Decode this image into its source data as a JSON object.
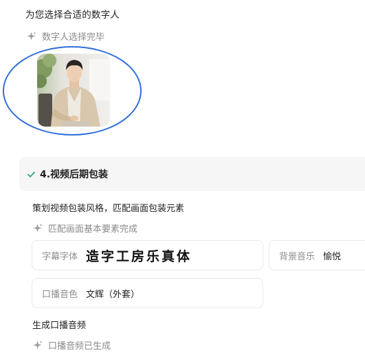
{
  "section_heading": "为您选择合适的数字人",
  "digital_human_status": "数字人选择完毕",
  "step": {
    "title": "4.视频后期包装",
    "description": "策划视频包装风格，匹配画面包装元素",
    "elements_status": "匹配画面基本要素完成",
    "fields": {
      "subtitle_font": {
        "label": "字幕字体",
        "value": "造字工房乐真体"
      },
      "background_music": {
        "label": "背景音乐",
        "value": "愉悦"
      },
      "voice_tone": {
        "label": "口播音色",
        "value": "文辉（外套）"
      }
    },
    "audio_heading": "生成口播音频",
    "audio_status": "口播音频已生成"
  },
  "colors": {
    "annotation_circle": "#2f6fd9",
    "check": "#3aa675",
    "muted_text": "#8a8a8a"
  }
}
